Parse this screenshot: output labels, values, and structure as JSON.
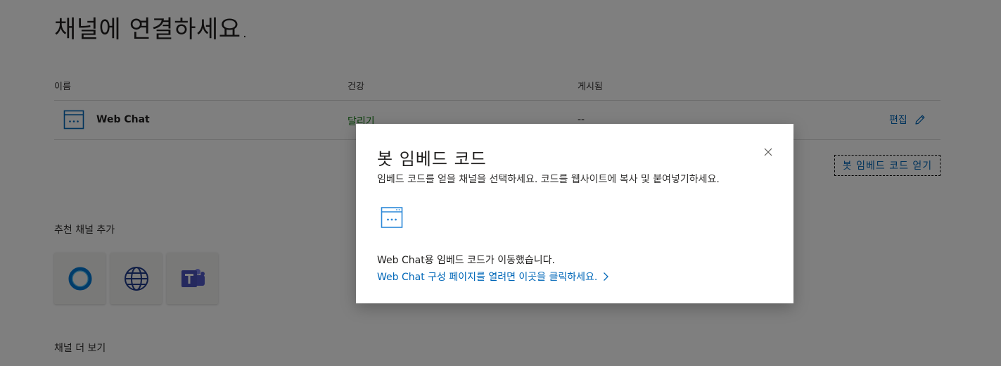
{
  "page": {
    "title": "채널에 연결하세요.",
    "table": {
      "headers": {
        "name": "이름",
        "health": "건강",
        "published": "게시됨"
      },
      "rows": [
        {
          "icon": "web-chat-icon",
          "name": "Web Chat",
          "health": "달리기",
          "published": "--",
          "action": "편집"
        }
      ]
    },
    "embed_button": "봇 임베드 코드 얻기",
    "recommended_label": "추천 채널 추가",
    "recommended_channels": [
      {
        "icon": "cortana-icon"
      },
      {
        "icon": "globe-icon"
      },
      {
        "icon": "teams-icon"
      }
    ],
    "more_channels_label": "채널 더 보기"
  },
  "dialog": {
    "title": "봇 임베드 코드",
    "subtitle": "임베드 코드를 얻을 채널을 선택하세요. 코드를 웹사이트에 복사 및 붙여넣기하세요.",
    "icon": "web-chat-icon",
    "moved_text": "Web Chat용 임베드 코드가 이동했습니다.",
    "link_text": "Web Chat 구성 페이지를 열려면 이곳을 클릭하세요."
  },
  "colors": {
    "accent": "#0067b8",
    "health_running": "#107c10",
    "teams_purple": "#5059c9",
    "cortana_blue": "#0078d4",
    "overlay": "rgba(0,0,0,0.5)"
  }
}
